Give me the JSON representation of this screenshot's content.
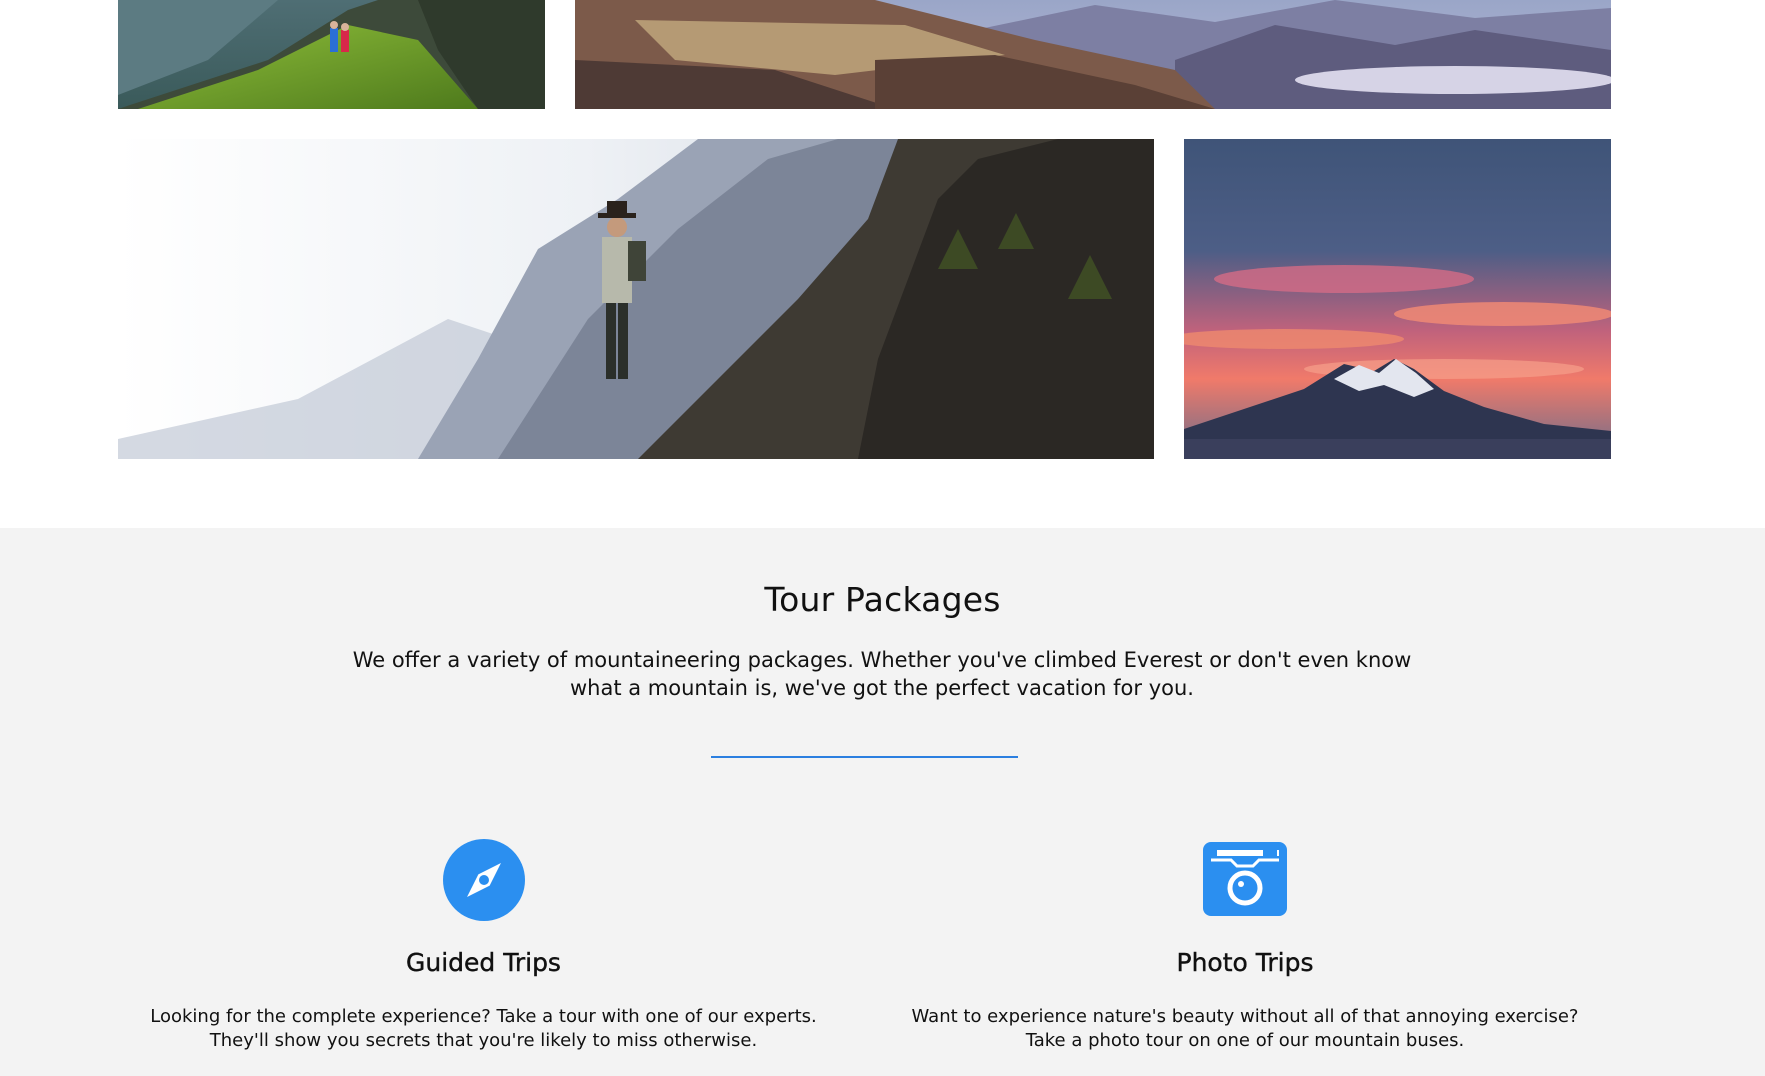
{
  "gallery": {
    "photos": [
      {
        "name": "hikers-on-green-ridge"
      },
      {
        "name": "valley-with-misty-mountains"
      },
      {
        "name": "hiker-on-rocky-cliff"
      },
      {
        "name": "sunset-over-snowy-peak"
      }
    ]
  },
  "tour_packages": {
    "title": "Tour Packages",
    "description": "We offer a variety of mountaineering packages. Whether you've climbed Everest or don't even know what a mountain is, we've got the perfect vacation for you.",
    "accent_color": "#2b7fe0",
    "items": [
      {
        "icon": "compass-icon",
        "title": "Guided Trips",
        "text": "Looking for the complete experience? Take a tour with one of our experts. They'll show you secrets that you're likely to miss otherwise."
      },
      {
        "icon": "camera-icon",
        "title": "Photo Trips",
        "text": "Want to experience nature's beauty without all of that annoying exercise? Take a photo tour on one of our mountain buses."
      }
    ]
  }
}
